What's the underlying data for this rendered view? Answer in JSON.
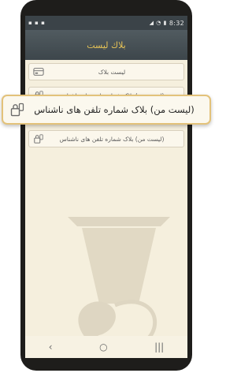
{
  "status_bar": {
    "time": "8:32",
    "icons_right": [
      "signal-icon",
      "wifi-icon",
      "battery-icon"
    ],
    "icons_left": [
      "notification-icon",
      "notification-icon",
      "notification-icon"
    ]
  },
  "app_bar": {
    "title": "بلاك لیست"
  },
  "menu": {
    "items": [
      {
        "label": "لیست بلاک"
      },
      {
        "label": "(لیست من) بلاک شماره تلفن های ناشناس"
      },
      {
        "label": "(لیست من) بلاک شماره تلفن های ناشناس"
      }
    ]
  },
  "highlight": {
    "label": "(لیست من) بلاک شماره تلفن های ناشناس"
  },
  "nav_bar": {
    "back": "‹",
    "home": "○",
    "recents": "|||"
  },
  "colors": {
    "accent": "#e8c456",
    "app_bar": "#3d464b",
    "background": "#f5efdd",
    "highlight_border": "#e3c27a"
  }
}
